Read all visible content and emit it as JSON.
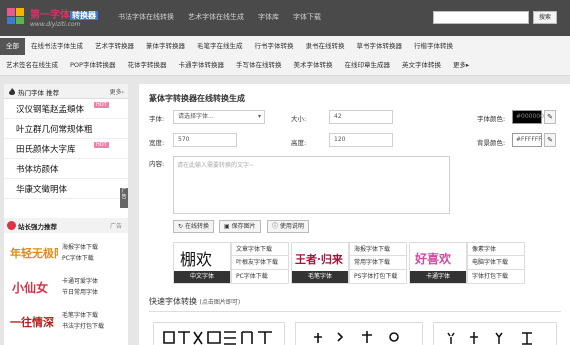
{
  "header": {
    "logo_title": "第一字体",
    "logo_tag": "转换器",
    "logo_url": "www.diyiziti.com",
    "nav": [
      "书法字体在线转换",
      "艺术字体在线生成",
      "字体库",
      "字体下载"
    ],
    "search_placeholder": "",
    "search_button": "搜索"
  },
  "categories": {
    "row1": [
      "全部",
      "在线书法字体生成",
      "艺术字转换器",
      "篆体字转换器",
      "毛笔字在线生成",
      "行书字体转换",
      "隶书在线转换",
      "草书字体转换器",
      "行楷字体转换"
    ],
    "row2": [
      "艺术签名在线生成",
      "POP字体转换器",
      "花体字转换器",
      "卡通字体转换器",
      "手写体在线转换",
      "美术字体转换",
      "在线印章生成器",
      "英文字体转换",
      "更多▸"
    ]
  },
  "sidebar": {
    "hot_title": "热门字体 推荐",
    "more": "更多›",
    "hot_badge": "HOT",
    "fonts": [
      {
        "name": "汉仪钢笔赵孟頫体",
        "hot": true
      },
      {
        "name": "叶立群几何常规体粗",
        "hot": false
      },
      {
        "name": "田氏颜体大字库",
        "hot": true
      },
      {
        "name": "书体坊颜体",
        "hot": false
      },
      {
        "name": "华康文徵明体",
        "hot": false
      }
    ],
    "side_tab": "广告",
    "station_title": "站长强力推荐",
    "station_ad": "广告",
    "stations": [
      {
        "art": "年轻无极限",
        "l1": "海报字体下载",
        "l2": "PC字体下载"
      },
      {
        "art": "小仙女",
        "l1": "卡通可爱字体",
        "l2": "节日常用字体"
      },
      {
        "art": "一往情深",
        "l1": "毛笔字体下载",
        "l2": "书法字打包下载"
      }
    ]
  },
  "main": {
    "title": "篆体字转换器在线转换生成",
    "font_label": "字体:",
    "font_select": "请选择字体...",
    "size_label": "大小:",
    "size_value": "42",
    "color_label": "字体颜色:",
    "color_value": "#000000",
    "width_label": "宽度:",
    "width_value": "570",
    "height_label": "高度:",
    "height_value": "120",
    "bg_label": "背景颜色:",
    "bg_value": "#FFFFFF",
    "content_label": "内容:",
    "content_placeholder": "请在此输入需要转换的文字~",
    "btn_convert": "在线转换",
    "btn_save": "保存图片",
    "btn_help": "使用说明",
    "cards": [
      {
        "art": "棚欢",
        "caption": "中文字体"
      },
      {
        "art": "王者·归来",
        "caption": "毛笔字体"
      },
      {
        "art": "好喜欢",
        "caption": "卡通字体"
      }
    ],
    "card_links": [
      [
        "文章字体下载",
        "叶根友字体下载",
        "PC字体下载"
      ],
      [
        "海报字体下载",
        "常用字体下载",
        "PS字体打包下载"
      ],
      [
        "像素字体",
        "电脑字体下载",
        "字体打包下载"
      ]
    ],
    "quick_title": "快速字体转换",
    "quick_hint": "(点击图片即可)"
  },
  "colors": {
    "accent": "#d6336c",
    "dark": "#4a4a4a"
  }
}
